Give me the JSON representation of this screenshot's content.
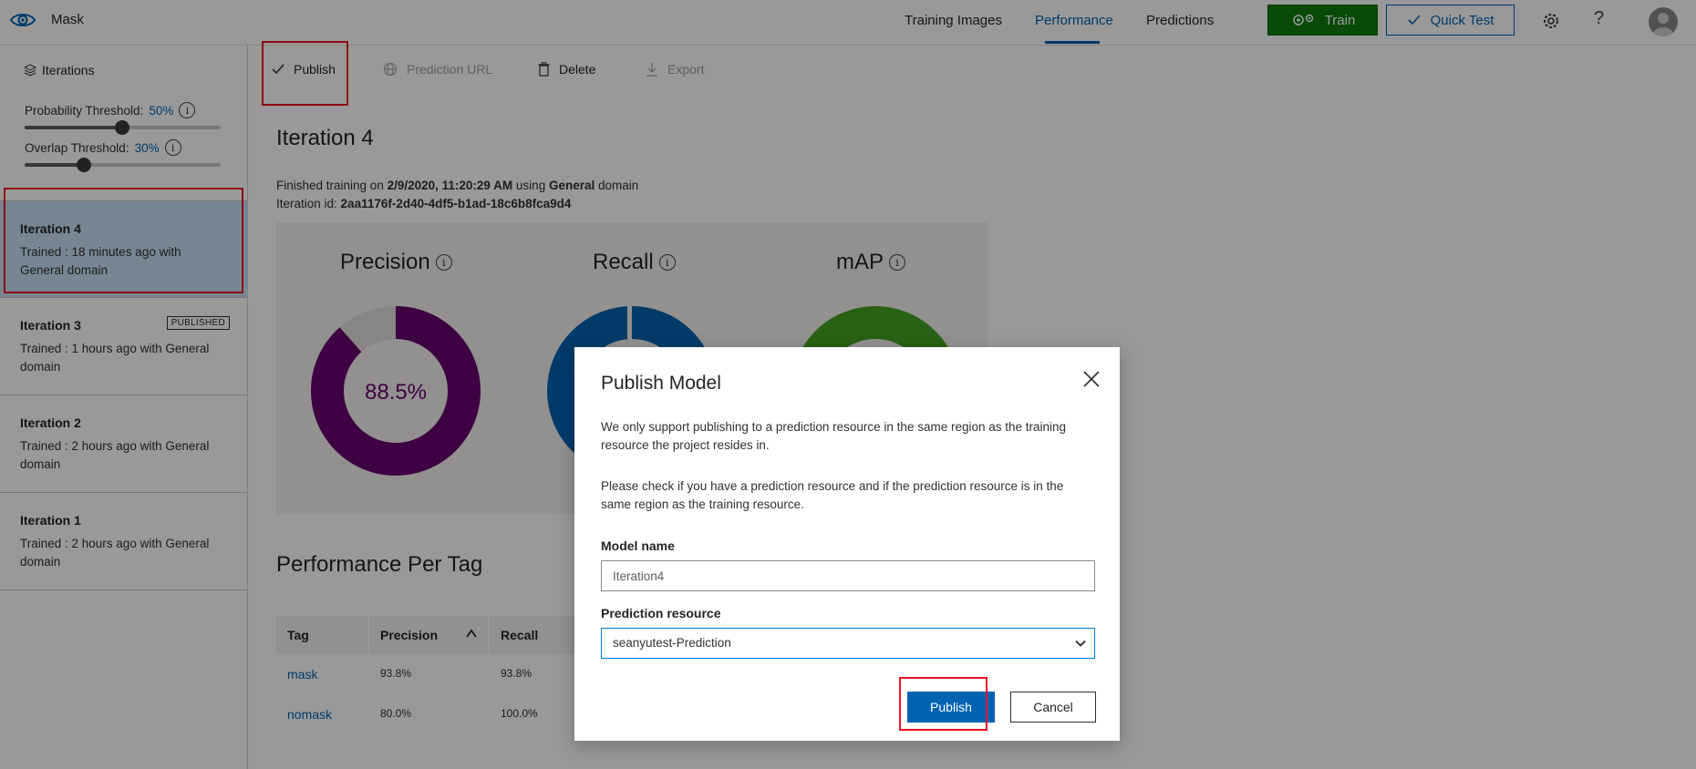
{
  "app": {
    "name": "Mask"
  },
  "nav": {
    "tabs": [
      {
        "label": "Training Images"
      },
      {
        "label": "Performance"
      },
      {
        "label": "Predictions"
      }
    ],
    "train_label": "Train",
    "quick_test_label": "Quick Test",
    "help_glyph": "?"
  },
  "sidebar": {
    "header": "Iterations",
    "probability": {
      "label": "Probability Threshold:",
      "value": "50%",
      "level": 0.5
    },
    "overlap": {
      "label": "Overlap Threshold:",
      "value": "30%",
      "level": 0.3
    },
    "items": [
      {
        "name": "Iteration 4",
        "desc": "Trained : 18 minutes ago with General domain"
      },
      {
        "name": "Iteration 3",
        "desc": "Trained : 1 hours ago with General domain",
        "badge": "PUBLISHED"
      },
      {
        "name": "Iteration 2",
        "desc": "Trained : 2 hours ago with General domain"
      },
      {
        "name": "Iteration 1",
        "desc": "Trained : 2 hours ago with General domain"
      }
    ]
  },
  "toolbar": {
    "publish": "Publish",
    "prediction_url": "Prediction URL",
    "delete": "Delete",
    "export": "Export"
  },
  "main": {
    "title": "Iteration 4",
    "finished_prefix": "Finished training on ",
    "finished_date": "2/9/2020, 11:20:29 AM",
    "finished_mid": " using ",
    "finished_domain": "General",
    "finished_suffix": " domain",
    "iteration_id_label": "Iteration id: ",
    "iteration_id": "2aa1176f-2d40-4df5-b1ad-18c6b8fca9d4",
    "metrics": [
      {
        "label": "Precision",
        "value_text": "88.5%",
        "value": 88.5,
        "color": "#68006e"
      },
      {
        "label": "Recall",
        "value": null,
        "color": "#0063b1"
      },
      {
        "label": "mAP",
        "value": null,
        "color": "#45a322"
      }
    ],
    "per_tag_title": "Performance Per Tag",
    "table": {
      "headers": [
        "Tag",
        "Precision",
        "Recall"
      ],
      "rows": [
        {
          "tag": "mask",
          "precision": "93.8%",
          "recall": "93.8%"
        },
        {
          "tag": "nomask",
          "precision": "80.0%",
          "recall": "100.0%"
        }
      ]
    }
  },
  "modal": {
    "title": "Publish Model",
    "text1": "We only support publishing to a prediction resource in the same region as the training resource the project resides in.",
    "text2": "Please check if you have a prediction resource and if the prediction resource is in the same region as the training resource.",
    "model_name_label": "Model name",
    "model_name_value": "Iteration4",
    "prediction_resource_label": "Prediction resource",
    "prediction_resource_value": "seanyutest-Prediction",
    "publish_label": "Publish",
    "cancel_label": "Cancel"
  },
  "colors": {
    "accent": "#0063b1",
    "train_green": "#107c10",
    "highlight_red": "#e81123",
    "precision_purple": "#68006e",
    "recall_blue": "#0063b1",
    "map_green": "#45a322"
  }
}
